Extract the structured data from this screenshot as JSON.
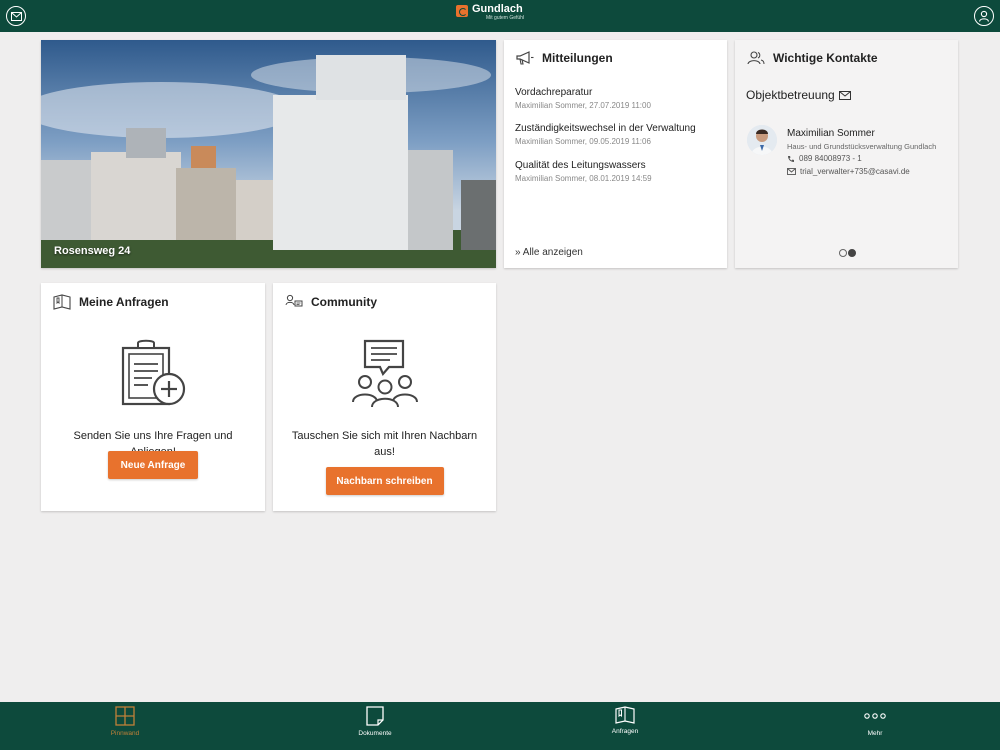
{
  "header": {
    "brand_name": "Gundlach",
    "brand_tagline": "Mit gutem Gefühl",
    "left_icon": "mail-icon",
    "right_icon": "user-icon"
  },
  "hero": {
    "label": "Rosensweg 24"
  },
  "messages": {
    "title": "Mitteilungen",
    "icon": "megaphone-icon",
    "items": [
      {
        "title": "Vordachreparatur",
        "sub": "Maximilian Sommer, 27.07.2019 11:00"
      },
      {
        "title": "Zuständigkeitswechsel in der Verwaltung",
        "sub": "Maximilian Sommer, 09.05.2019 11:06"
      },
      {
        "title": "Qualität des Leitungswassers",
        "sub": "Maximilian Sommer, 08.01.2019 14:59"
      }
    ],
    "show_all": "» Alle anzeigen"
  },
  "contacts": {
    "title": "Wichtige Kontakte",
    "icon": "contacts-icon",
    "role": "Objektbetreuung",
    "name": "Maximilian Sommer",
    "company": "Haus- und Grundstücksverwaltung Gundlach",
    "phone": "089 84008973 - 1",
    "email": "trial_verwalter+735@casavi.de"
  },
  "requests": {
    "title": "Meine Anfragen",
    "icon": "requests-icon",
    "text": "Senden Sie uns Ihre Fragen und Anliegen!",
    "button": "Neue Anfrage"
  },
  "community": {
    "title": "Community",
    "icon": "community-icon",
    "text": "Tauschen Sie sich mit Ihren Nachbarn aus!",
    "button": "Nachbarn schreiben"
  },
  "bottom_nav": {
    "items": [
      {
        "label": "Pinnwand",
        "icon": "dashboard-icon",
        "active": true
      },
      {
        "label": "Dokumente",
        "icon": "document-icon",
        "active": false
      },
      {
        "label": "Anfragen",
        "icon": "requests-icon",
        "active": false
      },
      {
        "label": "Mehr",
        "icon": "more-icon",
        "active": false
      }
    ]
  },
  "colors": {
    "brand_green": "#0d4a3c",
    "accent_orange": "#e8722d",
    "background": "#efeeee"
  }
}
